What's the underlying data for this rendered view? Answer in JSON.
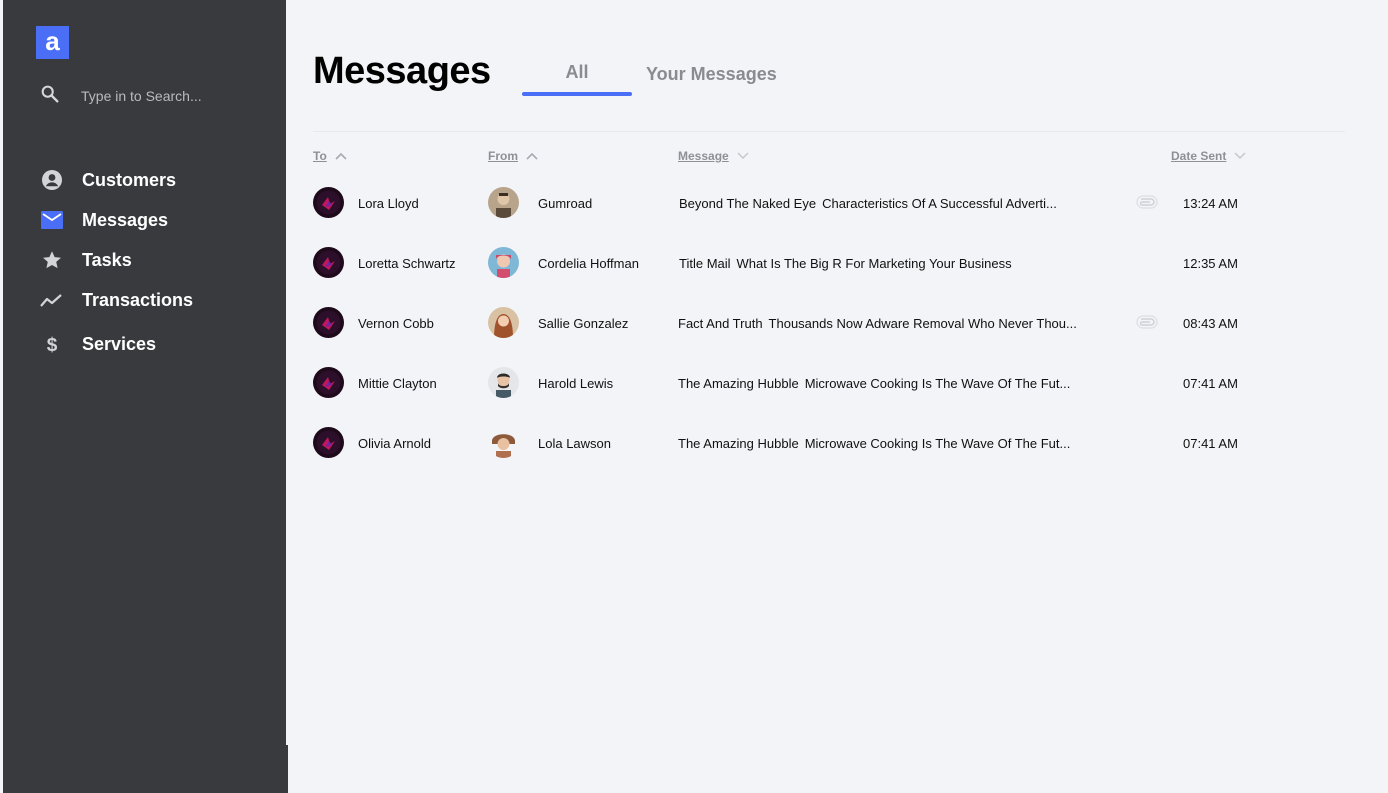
{
  "sidebar": {
    "logo_letter": "a",
    "search_placeholder": "Type in to Search...",
    "items": [
      {
        "label": "Customers",
        "icon": "user-circle-icon"
      },
      {
        "label": "Messages",
        "icon": "envelope-icon"
      },
      {
        "label": "Tasks",
        "icon": "star-icon"
      },
      {
        "label": "Transactions",
        "icon": "trend-line-icon"
      },
      {
        "label": "Services",
        "icon": "dollar-icon"
      }
    ]
  },
  "main": {
    "title": "Messages",
    "tabs": [
      {
        "label": "All",
        "active": true
      },
      {
        "label": "Your Messages",
        "active": false
      }
    ],
    "columns": {
      "to": "To",
      "from": "From",
      "message": "Message",
      "date_sent": "Date Sent"
    },
    "rows": [
      {
        "to": "Lora Lloyd",
        "from": "Gumroad",
        "subject": "Beyond The Naked Eye",
        "preview": "Characteristics Of A Successful Adverti...",
        "attachment": true,
        "time": "13:24 AM"
      },
      {
        "to": "Loretta Schwartz",
        "from": "Cordelia Hoffman",
        "subject": "Title Mail",
        "preview": "What Is The Big R For Marketing Your Business",
        "attachment": false,
        "time": "12:35 AM"
      },
      {
        "to": "Vernon Cobb",
        "from": "Sallie Gonzalez",
        "subject": "Fact And Truth",
        "preview": "Thousands Now Adware Removal Who Never Thou...",
        "attachment": true,
        "time": "08:43 AM"
      },
      {
        "to": "Mittie Clayton",
        "from": "Harold Lewis",
        "subject": "The Amazing Hubble",
        "preview": "Microwave Cooking Is The Wave Of The Fut...",
        "attachment": false,
        "time": "07:41 AM"
      },
      {
        "to": "Olivia Arnold",
        "from": "Lola Lawson",
        "subject": "The Amazing Hubble",
        "preview": "Microwave Cooking Is The Wave Of The Fut...",
        "attachment": false,
        "time": "07:41 AM"
      }
    ]
  },
  "colors": {
    "sidebar_bg": "#393a3e",
    "accent": "#4a6ef5",
    "page_bg": "#f3f4f8"
  }
}
